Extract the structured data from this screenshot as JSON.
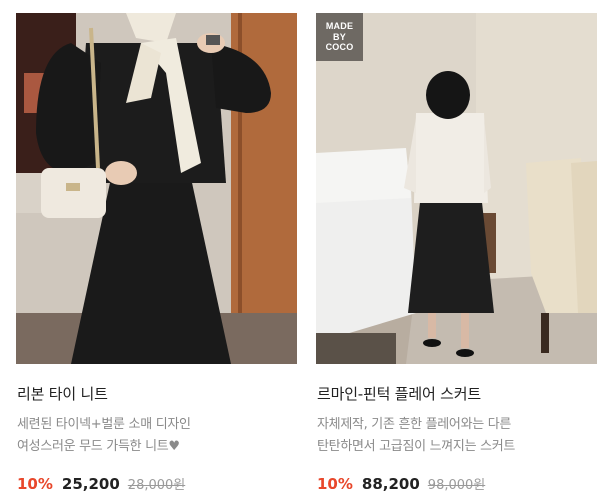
{
  "products": [
    {
      "image_alt": "리본 타이 니트",
      "badge": [],
      "title": "리본 타이 니트",
      "desc_line1": "세련된 타이넥+벌룬 소매 디자인",
      "desc_line2": "여성스러운 무드 가득한 니트♥",
      "discount": "10%",
      "sale_price": "25,200",
      "original_price": "28,000원"
    },
    {
      "image_alt": "르마인-핀턱 플레어 스커트",
      "badge": [
        "MADE",
        "BY",
        "COCO"
      ],
      "title": "르마인-핀턱 플레어 스커트",
      "desc_line1": "자체제작, 기존 흔한 플레어와는 다른",
      "desc_line2": "탄탄하면서 고급짐이 느껴지는 스커트",
      "discount": "10%",
      "sale_price": "88,200",
      "original_price": "98,000원"
    }
  ]
}
